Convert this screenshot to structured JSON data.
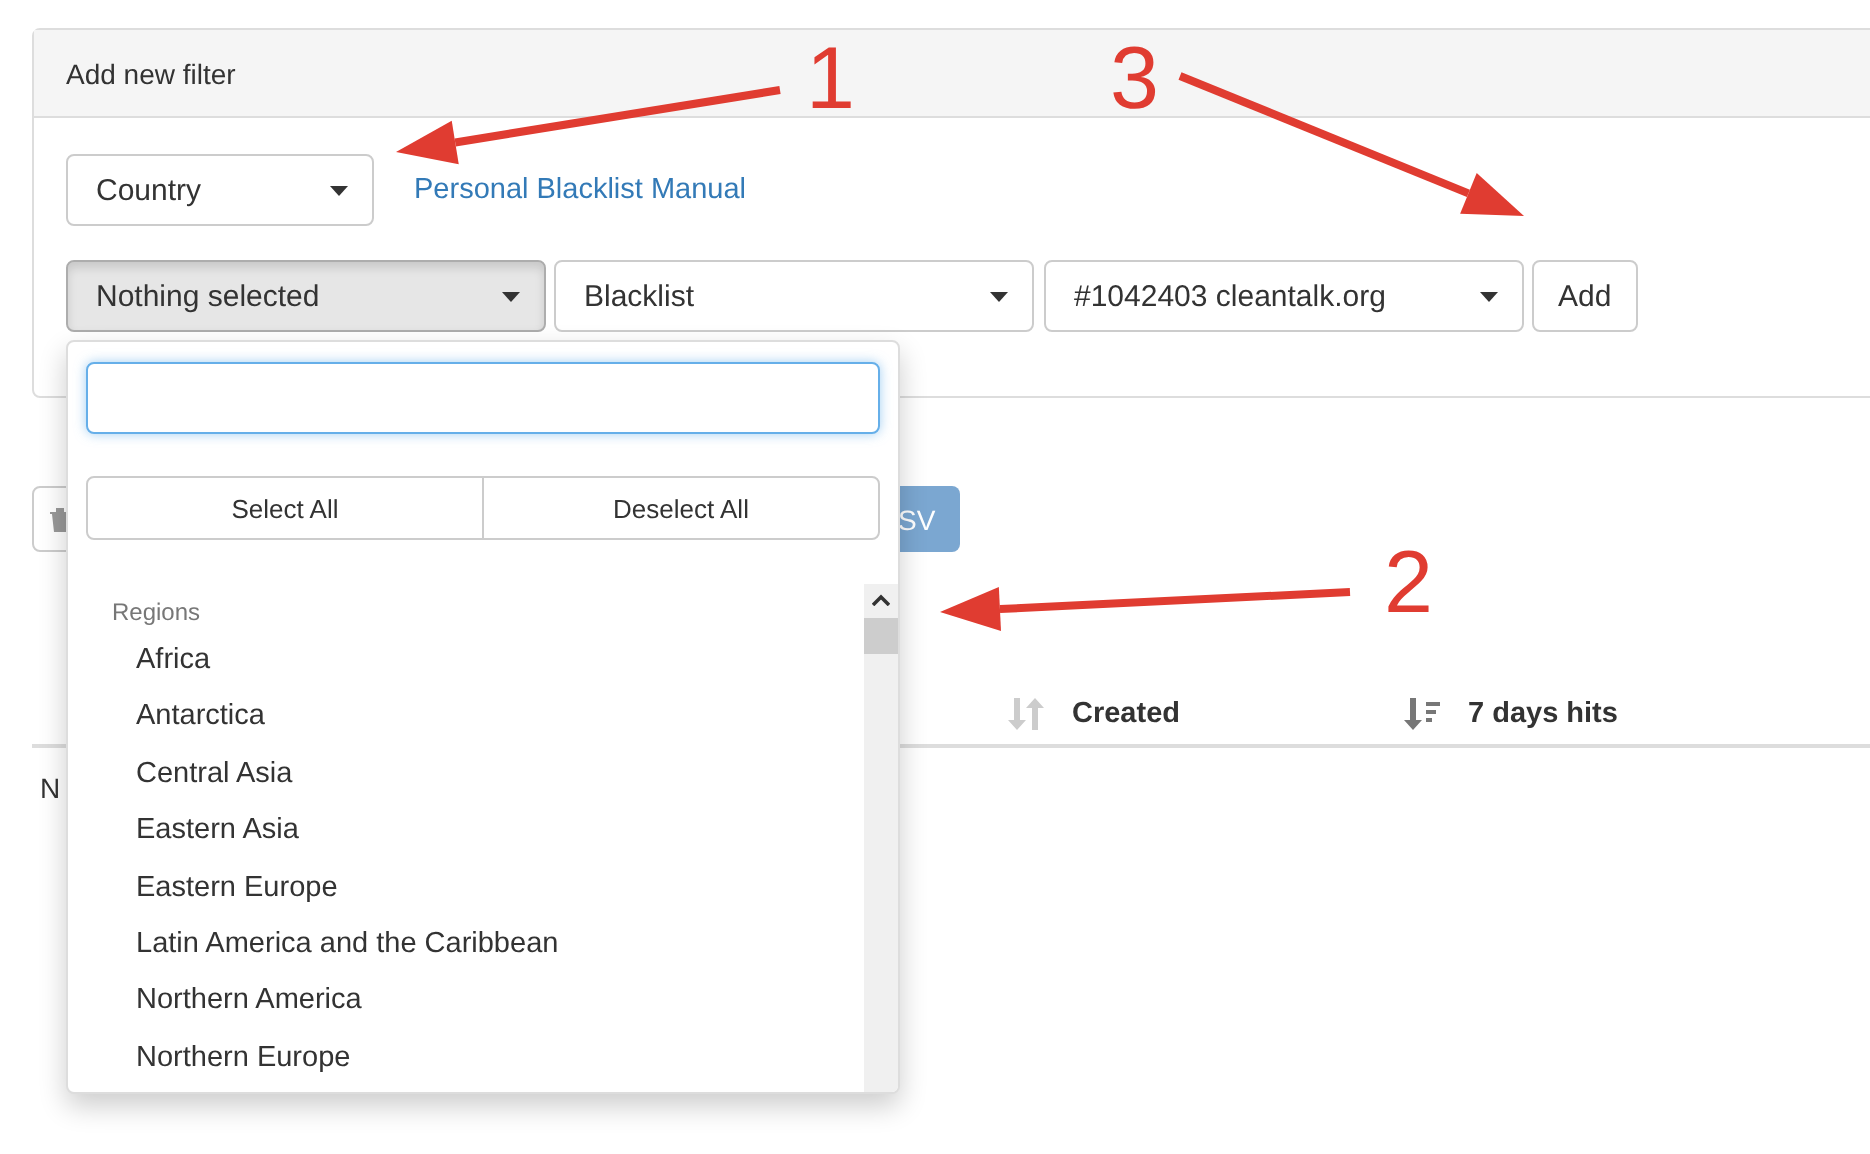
{
  "panel": {
    "title": "Add new filter"
  },
  "type_select": {
    "value": "Country"
  },
  "manual_link": {
    "label": "Personal Blacklist Manual"
  },
  "filter_row": {
    "country_select": {
      "value": "Nothing selected",
      "expanded": true
    },
    "list_select": {
      "value": "Blacklist"
    },
    "site_select": {
      "value": "#1042403 cleantalk.org"
    },
    "add_button": {
      "label": "Add"
    }
  },
  "toolbar": {
    "export_button": {
      "label": "SV"
    }
  },
  "table": {
    "columns": [
      {
        "label": "Created",
        "sorted": false
      },
      {
        "label": "7 days hits",
        "sorted": true
      }
    ],
    "empty_text": "N"
  },
  "dropdown": {
    "buttons": [
      {
        "label": "Select All"
      },
      {
        "label": "Deselect All"
      }
    ],
    "group": "Regions",
    "items": [
      {
        "label": "Africa"
      },
      {
        "label": "Antarctica"
      },
      {
        "label": "Central Asia"
      },
      {
        "label": "Eastern Asia"
      },
      {
        "label": "Eastern Europe"
      },
      {
        "label": "Latin America and the Caribbean"
      },
      {
        "label": "Northern America"
      },
      {
        "label": "Northern Europe"
      }
    ]
  },
  "annotations": [
    {
      "label": "1"
    },
    {
      "label": "2"
    },
    {
      "label": "3"
    }
  ]
}
